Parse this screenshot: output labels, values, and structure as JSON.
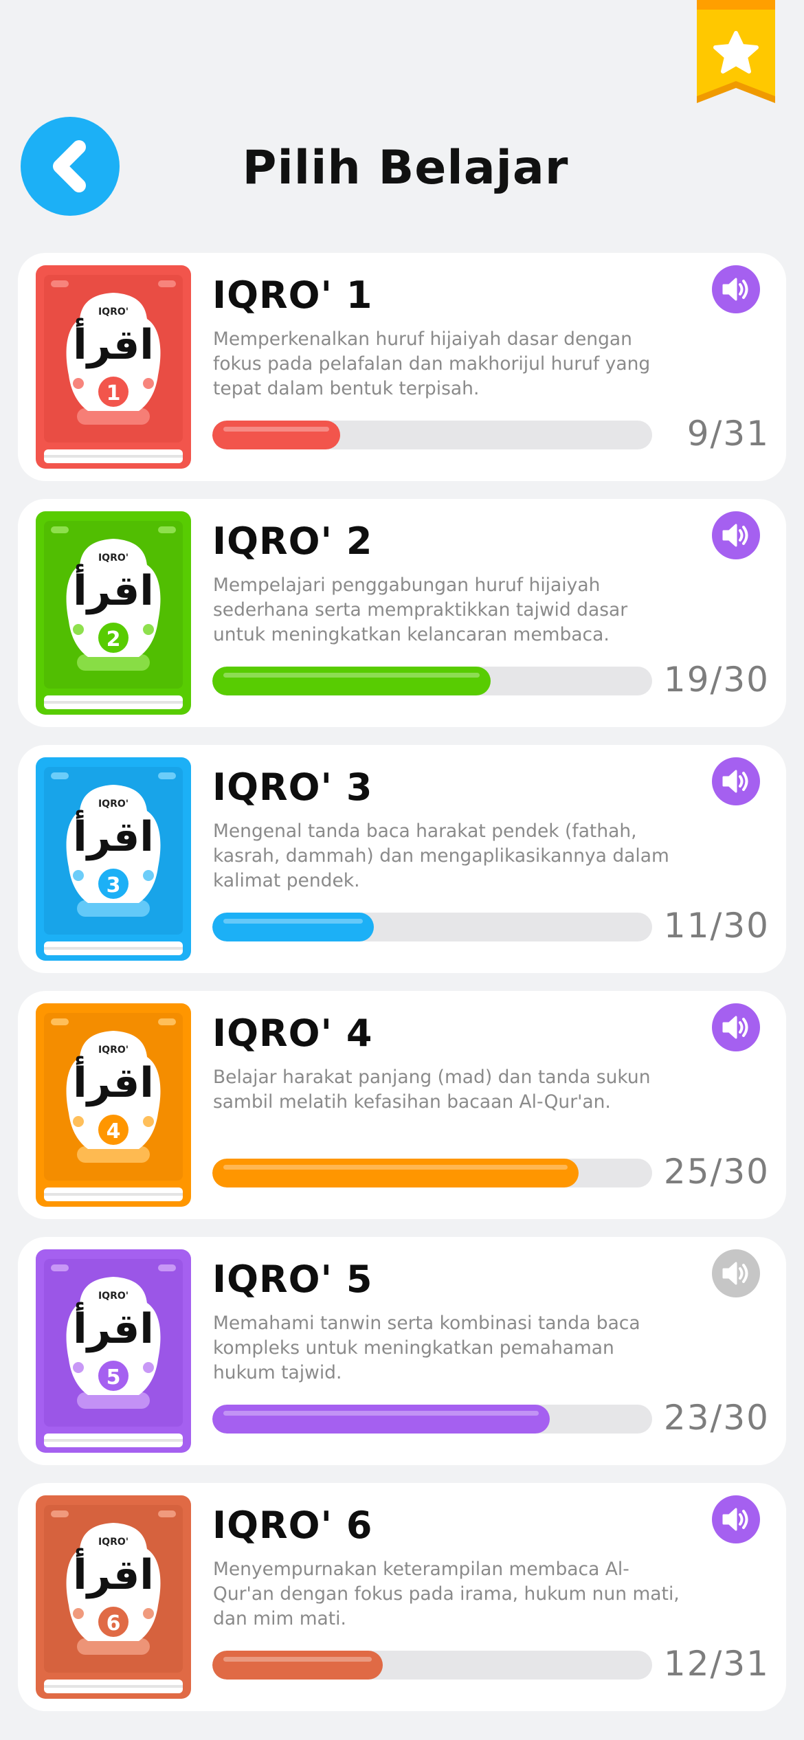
{
  "header": {
    "title": "Pilih Belajar",
    "back_icon": "chevron-left-icon",
    "ribbon_icon": "star-icon"
  },
  "colors": {
    "back_button": "#1cb0f6",
    "sound_active": "#a560f0",
    "sound_inactive": "#c6c6c6",
    "track": "#e6e6e8"
  },
  "cover_text": {
    "label": "IQRO'",
    "arabic": "اقرأ"
  },
  "books": [
    {
      "title": "IQRO' 1",
      "number": "1",
      "description": "Memperkenalkan huruf hijaiyah dasar dengan fokus pada pelafalan dan makhorijul huruf yang tepat dalam bentuk terpisah.",
      "progress_text": "9/31",
      "progress": 0.29,
      "color": "#f2554c",
      "color_dark": "#d93f37",
      "color_light": "#f7847c",
      "sound_enabled": true
    },
    {
      "title": "IQRO' 2",
      "number": "2",
      "description": "Mempelajari penggabungan huruf hijaiyah sederhana serta mempraktikkan tajwid dasar untuk meningkatkan kelancaran membaca.",
      "progress_text": "19/30",
      "progress": 0.633,
      "color": "#58cc02",
      "color_dark": "#46a302",
      "color_light": "#8ee04d",
      "sound_enabled": true
    },
    {
      "title": "IQRO' 3",
      "number": "3",
      "description": "Mengenal tanda baca harakat pendek (fathah, kasrah, dammah) dan mengaplikasikannya dalam kalimat pendek.",
      "progress_text": "11/30",
      "progress": 0.367,
      "color": "#1cb0f6",
      "color_dark": "#1290d0",
      "color_light": "#6ccdf9",
      "sound_enabled": true
    },
    {
      "title": "IQRO' 4",
      "number": "4",
      "description": "Belajar harakat panjang (mad) dan tanda sukun sambil melatih kefasihan bacaan Al-Qur'an.",
      "progress_text": "25/30",
      "progress": 0.833,
      "color": "#ff9600",
      "color_dark": "#e07e00",
      "color_light": "#ffbf5a",
      "sound_enabled": true
    },
    {
      "title": "IQRO' 5",
      "number": "5",
      "description": "Memahami tanwin serta kombinasi tanda baca kompleks untuk meningkatkan pemahaman hukum tajwid.",
      "progress_text": "23/30",
      "progress": 0.767,
      "color": "#a560f0",
      "color_dark": "#8a45d6",
      "color_light": "#c898f6",
      "sound_enabled": false
    },
    {
      "title": "IQRO' 6",
      "number": "6",
      "description": "Menyempurnakan keterampilan membaca Al-Qur'an dengan fokus pada irama, hukum nun mati, dan mim mati.",
      "progress_text": "12/31",
      "progress": 0.387,
      "color": "#e06a45",
      "color_dark": "#c25432",
      "color_light": "#f09a7d",
      "sound_enabled": true
    }
  ]
}
